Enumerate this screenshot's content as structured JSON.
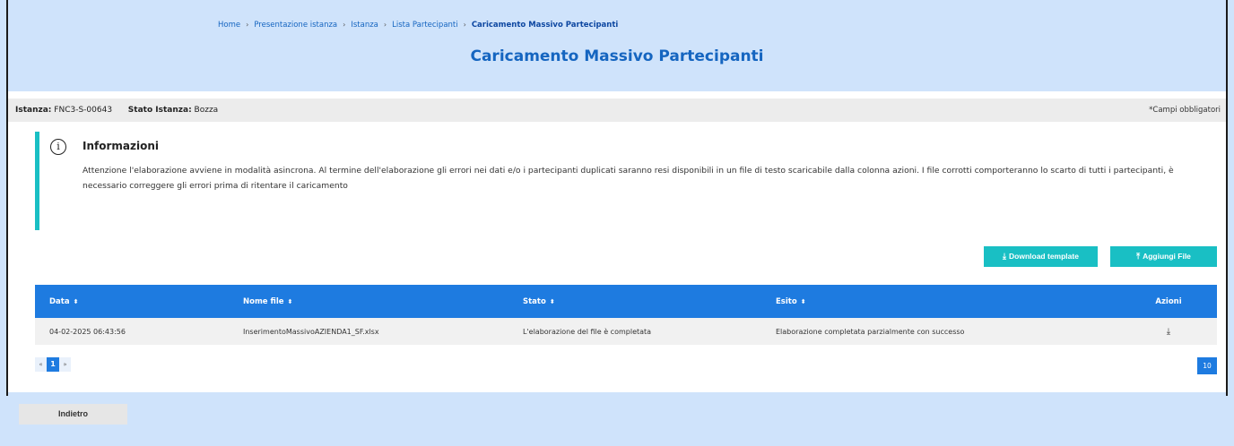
{
  "breadcrumb": {
    "items": [
      "Home",
      "Presentazione istanza",
      "Istanza",
      "Lista Partecipanti"
    ],
    "current": "Caricamento Massivo Partecipanti"
  },
  "page_title": "Caricamento Massivo Partecipanti",
  "infobar": {
    "istanza_label": "Istanza:",
    "istanza_value": "FNC3-S-00643",
    "stato_label": "Stato Istanza:",
    "stato_value": "Bozza",
    "required_note": "*Campi obbligatori"
  },
  "notice": {
    "icon": "info-icon",
    "title": "Informazioni",
    "text": "Attenzione l'elaborazione avviene in modalità asincrona. Al termine dell'elaborazione gli errori nei dati e/o i partecipanti duplicati saranno resi disponibili in un file di testo scaricabile dalla colonna azioni. I file corrotti comporteranno lo scarto di tutti i partecipanti, è necessario correggere gli errori prima di ritentare il caricamento"
  },
  "buttons": {
    "download_template": "Download template",
    "add_file": "Aggiungi File",
    "back": "Indietro"
  },
  "table": {
    "headers": [
      "Data",
      "Nome file",
      "Stato",
      "Esito",
      "Azioni"
    ],
    "rows": [
      {
        "data": "04-02-2025 06:43:56",
        "nome_file": "InserimentoMassivoAZIENDA1_SF.xlsx",
        "stato": "L'elaborazione del file è completata",
        "esito": "Elaborazione completata parzialmente con successo",
        "azione_icon": "download-icon"
      }
    ]
  },
  "pagination": {
    "prev": "«",
    "current": "1",
    "next": "»",
    "page_size": "10"
  },
  "colors": {
    "primary": "#1e7be0",
    "teal": "#19bfc4",
    "background": "#cfe3fb"
  }
}
